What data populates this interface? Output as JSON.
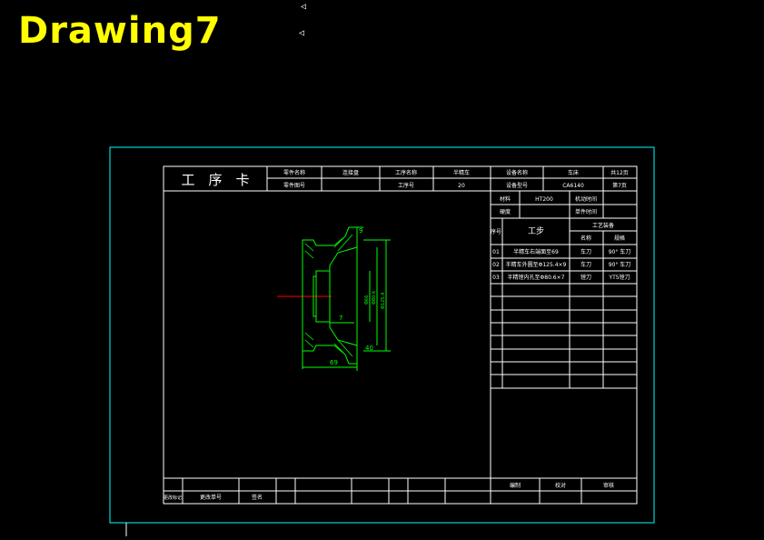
{
  "title": "Drawing7",
  "ucs_marks": [
    "◁",
    "◁"
  ],
  "colors": {
    "background": "#000000",
    "title": "#ffff00",
    "frame": "#00ffff",
    "lines": "#ffffff",
    "part": "#00ff00",
    "centerline": "#ff0000"
  },
  "card": {
    "heading": "工　序　卡",
    "header": {
      "part_name_label": "零件名称",
      "part_name": "连接盘",
      "part_no_label": "零件图号",
      "part_no": "",
      "process_name_label": "工序名称",
      "process_name": "半精车",
      "process_no_label": "工序号",
      "process_no": "20",
      "equipment_name_label": "设备名称",
      "equipment_name": "车床",
      "equipment_model_label": "设备型号",
      "equipment_model": "CA6140",
      "total_pages": "共12页",
      "page": "第7页"
    },
    "material_label": "材料",
    "material": "HT200",
    "machine_time_label": "机动时间",
    "machine_time": "",
    "hardness_label": "硬度",
    "hardness": "",
    "aux_time_label": "单件时间",
    "aux_time": "",
    "seq_label": "序号",
    "step_label": "工步",
    "equip_label": "工艺装备",
    "name_label": "名称",
    "spec_label": "规格",
    "steps": [
      {
        "no": "01",
        "desc": "半精车右端面至69",
        "tool": "车刀",
        "spec": "90° 车刀"
      },
      {
        "no": "02",
        "desc": "半精车外圆至Φ125.4×9",
        "tool": "车刀",
        "spec": "90° 车刀"
      },
      {
        "no": "03",
        "desc": "半精镗内孔至Φ80.6×7",
        "tool": "镗刀",
        "spec": "YT5镗刀"
      }
    ],
    "footer": {
      "mark_label": "更改标记",
      "doc_no_label": "更改单号",
      "sign_label": "签名",
      "designer": "编制",
      "checker": "校对",
      "approver": "审核"
    },
    "dims": {
      "d1": "9",
      "d2": "7",
      "d3": "69",
      "d4": "Φ125.4",
      "d5": "Φ80.6",
      "d6": "Φ66",
      "d7": "40"
    }
  }
}
